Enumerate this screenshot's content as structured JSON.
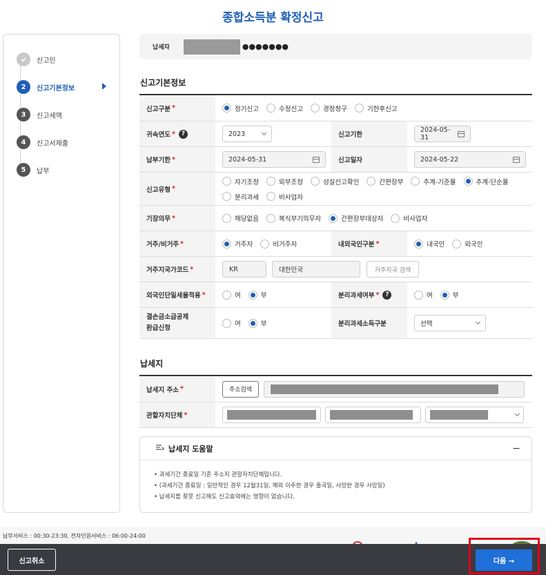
{
  "page_title": "종합소득분 확정신고",
  "steps": [
    {
      "num": "",
      "label": "신고인",
      "state": "done"
    },
    {
      "num": "2",
      "label": "신고기본정보",
      "state": "active"
    },
    {
      "num": "3",
      "label": "신고세액",
      "state": "pending"
    },
    {
      "num": "4",
      "label": "신고서제출",
      "state": "pending"
    },
    {
      "num": "5",
      "label": "납부",
      "state": "pending"
    }
  ],
  "payer": {
    "label": "납세자",
    "masked_suffix": "●●●●●●●"
  },
  "basic_section_title": "신고기본정보",
  "basic": {
    "report_type": {
      "label": "신고구분",
      "options": [
        "정기신고",
        "수정신고",
        "경정청구",
        "기한후신고"
      ],
      "selected": 0
    },
    "year": {
      "label": "귀속연도",
      "value": "2023"
    },
    "deadline": {
      "label": "신고기한",
      "value": "2024-05-31"
    },
    "pay_deadline": {
      "label": "납부기한",
      "value": "2024-05-31"
    },
    "report_date": {
      "label": "신고일자",
      "value": "2024-05-22"
    },
    "report_kind": {
      "label": "신고유형",
      "options": [
        "자기조정",
        "외부조정",
        "성실신고확인",
        "간편장부",
        "추계-기준율",
        "추계-단순율",
        "분리과세",
        "비사업자"
      ],
      "selected": 5
    },
    "bookkeeping": {
      "label": "기장의무",
      "options": [
        "해당없음",
        "복식부기의무자",
        "간편장부대상자",
        "비사업자"
      ],
      "selected": 2
    },
    "residency": {
      "label": "거주/비거주",
      "options": [
        "거주자",
        "비거주자"
      ],
      "selected": 0
    },
    "nationality": {
      "label": "내외국인구분",
      "options": [
        "내국인",
        "외국인"
      ],
      "selected": 0
    },
    "country": {
      "label": "거주지국가코드",
      "code": "KR",
      "name": "대한민국",
      "search_button": "거주지국 검색"
    },
    "foreign_flat": {
      "label": "외국인단일세율적용",
      "options": [
        "여",
        "부"
      ],
      "selected": 1
    },
    "separate_tax": {
      "label": "분리과세여부",
      "options": [
        "여",
        "부"
      ],
      "selected": 1
    },
    "loss_refund": {
      "label1": "결손금소급공제",
      "label2": "환급신청",
      "options": [
        "여",
        "부"
      ],
      "selected": 1
    },
    "separate_income": {
      "label": "분리과세소득구분",
      "value": "선택"
    }
  },
  "place_section_title": "납세지",
  "place": {
    "address": {
      "label": "납세지 주소",
      "button": "주소검색"
    },
    "local_gov": {
      "label": "관할자치단체"
    }
  },
  "help": {
    "title": "납세지 도움말",
    "collapse": "−",
    "lines": [
      "• 과세기간 종료일 기준 주소지 관할자치단체입니다.",
      "• (과세기간 종료일 : 일반적인 경우 12월31일, 해외 이주한 경우 출국일, 사망한 경우 사망일)",
      "• 납세지를 잘못 신고해도 신고효력에는 영향이 없습니다."
    ]
  },
  "footer": {
    "service_hours": "납부서비스 : 00:30-23:30, 전자민원서비스 : 06:00-24:00"
  },
  "buttons": {
    "cancel": "신고취소",
    "next": "다음 →"
  },
  "colors": {
    "primary": "#1f5fb8",
    "next_button": "#1f6fd8",
    "highlight": "#e0001b",
    "bottom_bar": "#3a3b40"
  }
}
